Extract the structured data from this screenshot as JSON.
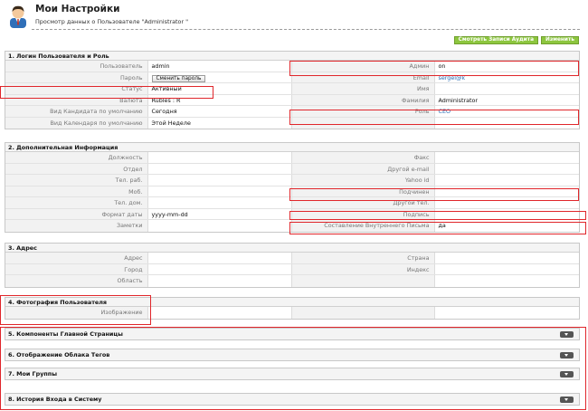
{
  "header": {
    "title": "Мои Настройки",
    "subtitle": "Просмотр данных о Пользователе \"Administrator \""
  },
  "buttons": {
    "audit": "Смотреть Записи Аудита",
    "edit": "Изменить"
  },
  "login": {
    "title": "1. Логин Пользователя и Роль",
    "rows": [
      [
        {
          "label": "Пользователь",
          "value": "admin"
        },
        {
          "label": "Админ",
          "value": "on"
        }
      ],
      [
        {
          "label": "Пароль",
          "button": "Сменить пароль"
        },
        {
          "label": "Email",
          "value": "sergei@k",
          "link": true
        }
      ],
      [
        {
          "label": "Статус",
          "value": "Активный"
        },
        {
          "label": "Имя",
          "value": ""
        }
      ],
      [
        {
          "label": "Валюта",
          "value": "Rubles : R"
        },
        {
          "label": "Фамилия",
          "value": "Administrator"
        }
      ],
      [
        {
          "label": "Вид Кандидата по умолчанию",
          "value": "Сегодня"
        },
        {
          "label": "Роль",
          "value": "CEO",
          "link": true
        }
      ],
      [
        {
          "label": "Вид Календаря по умолчанию",
          "value": "Этой Неделе"
        },
        {
          "label": "",
          "value": ""
        }
      ]
    ]
  },
  "extra": {
    "title": "2. Дополнительная Информация",
    "rows": [
      [
        {
          "label": "Должность",
          "value": ""
        },
        {
          "label": "Факс",
          "value": ""
        }
      ],
      [
        {
          "label": "Отдел",
          "value": ""
        },
        {
          "label": "Другой e-mail",
          "value": ""
        }
      ],
      [
        {
          "label": "Тел. раб.",
          "value": ""
        },
        {
          "label": "Yahoo id",
          "value": ""
        }
      ],
      [
        {
          "label": "Моб.",
          "value": ""
        },
        {
          "label": "Подчинен",
          "value": ""
        }
      ],
      [
        {
          "label": "Тел. дом.",
          "value": ""
        },
        {
          "label": "Другой тел.",
          "value": ""
        }
      ],
      [
        {
          "label": "Формат даты",
          "value": "yyyy-mm-dd"
        },
        {
          "label": "Подпись",
          "value": ""
        }
      ],
      [
        {
          "label": "Заметки",
          "value": ""
        },
        {
          "label": "Составление Внутреннего Письма",
          "value": "да"
        }
      ]
    ]
  },
  "address": {
    "title": "3. Адрес",
    "rows": [
      [
        {
          "label": "Адрес",
          "value": ""
        },
        {
          "label": "Страна",
          "value": ""
        }
      ],
      [
        {
          "label": "Город",
          "value": ""
        },
        {
          "label": "Индекс",
          "value": ""
        }
      ],
      [
        {
          "label": "Область",
          "value": ""
        },
        {
          "label": "",
          "value": ""
        }
      ]
    ]
  },
  "photo": {
    "title": "4. Фотография Пользователя",
    "label": "Изображение"
  },
  "collapsed": [
    "5. Компоненты Главной Страницы",
    "6. Отображение Облака Тегов",
    "7. Мои Группы",
    "8. История Входа в Систему"
  ],
  "colors": {
    "accent_green": "#8dc63f",
    "highlight_red": "#e0262b",
    "link_blue": "#2a6db5"
  }
}
